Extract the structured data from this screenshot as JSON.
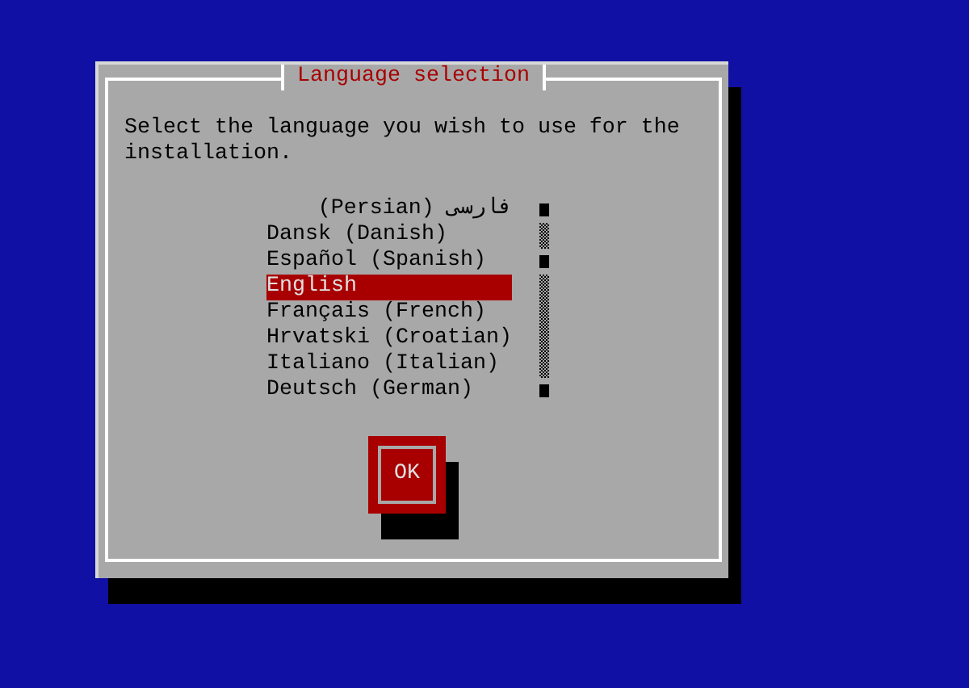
{
  "dialog": {
    "title": "Language selection",
    "prompt": "Select the language you wish to use for the installation.",
    "languages": [
      {
        "label": "فارسی (Persian)",
        "selected": false
      },
      {
        "label": "Dansk (Danish)",
        "selected": false
      },
      {
        "label": "Español (Spanish)",
        "selected": false
      },
      {
        "label": "English",
        "selected": true
      },
      {
        "label": "Français (French)",
        "selected": false
      },
      {
        "label": "Hrvatski (Croatian)",
        "selected": false
      },
      {
        "label": "Italiano (Italian)",
        "selected": false
      },
      {
        "label": "Deutsch (German)",
        "selected": false
      }
    ],
    "buttons": [
      "OK"
    ]
  }
}
